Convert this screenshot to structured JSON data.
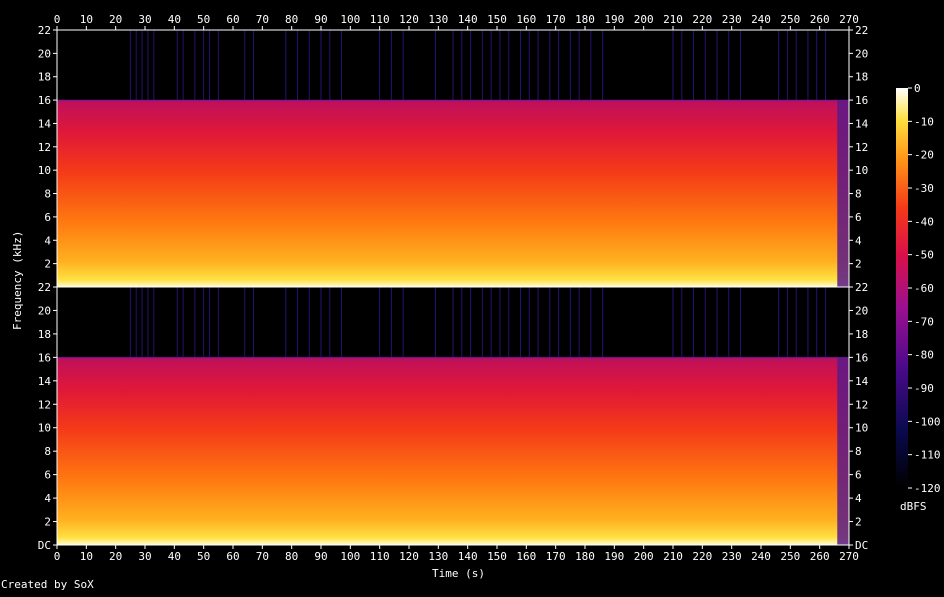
{
  "chart_data": {
    "type": "heatmap",
    "title": "",
    "xlabel": "Time (s)",
    "ylabel": "Frequency (kHz)",
    "xlim": [
      0,
      270
    ],
    "ylim": [
      0,
      22
    ],
    "x_ticks": [
      "0",
      "10",
      "20",
      "30",
      "40",
      "50",
      "60",
      "70",
      "80",
      "90",
      "100",
      "110",
      "120",
      "130",
      "140",
      "150",
      "160",
      "170",
      "180",
      "190",
      "200",
      "210",
      "220",
      "230",
      "240",
      "250",
      "260",
      "270"
    ],
    "y_ticks_channel_1": [
      "2",
      "4",
      "6",
      "8",
      "10",
      "12",
      "14",
      "16",
      "18",
      "20",
      "22"
    ],
    "y_ticks_channel_2": [
      "DC",
      "2",
      "4",
      "6",
      "8",
      "10",
      "12",
      "14",
      "16",
      "18",
      "20",
      "22"
    ],
    "colorbar": {
      "label": "dBFS",
      "ticks": [
        "0",
        "-10",
        "-20",
        "-30",
        "-40",
        "-50",
        "-60",
        "-70",
        "-80",
        "-90",
        "-100",
        "-110",
        "-120"
      ],
      "range": [
        -120,
        0
      ]
    },
    "channels": 2,
    "cutoff_khz": 16,
    "credit": "Created by SoX"
  }
}
